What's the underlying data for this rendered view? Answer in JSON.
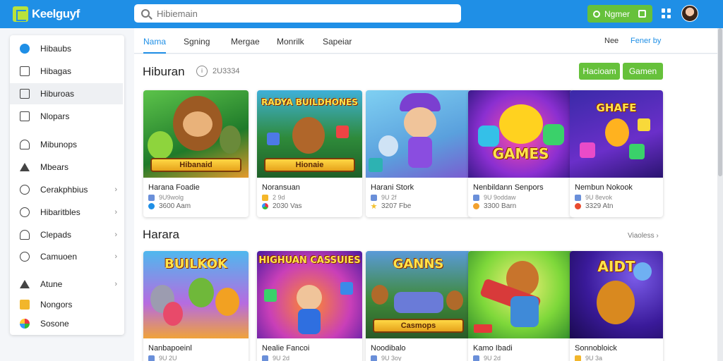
{
  "app": {
    "logo_text": "Keelguyf"
  },
  "search": {
    "placeholder": "Hibiemain"
  },
  "header": {
    "button_label": "Ngmer",
    "icons": [
      "grid-icon",
      "avatar"
    ]
  },
  "sidebar": {
    "items": [
      {
        "label": "Hibaubs",
        "icon": "globe-icon",
        "chevron": false,
        "active": false
      },
      {
        "label": "Hibagas",
        "icon": "list-icon",
        "chevron": false,
        "active": false
      },
      {
        "label": "Hiburoas",
        "icon": "document-icon",
        "chevron": false,
        "active": true
      },
      {
        "label": "Nlopars",
        "icon": "folder-icon",
        "chevron": false,
        "active": false
      },
      {
        "label": "Mibunops",
        "icon": "shirt-icon",
        "chevron": false,
        "active": false
      },
      {
        "label": "Mbears",
        "icon": "tag-icon",
        "chevron": false,
        "active": false
      },
      {
        "label": "Cerakphbius",
        "icon": "compass-icon",
        "chevron": true,
        "active": false
      },
      {
        "label": "Hibaritbles",
        "icon": "clock-icon",
        "chevron": true,
        "active": false
      },
      {
        "label": "Clepads",
        "icon": "bell-icon",
        "chevron": true,
        "active": false
      },
      {
        "label": "Camuoen",
        "icon": "info-icon",
        "chevron": true,
        "active": false
      },
      {
        "label": "Atune",
        "icon": "triangle-icon",
        "chevron": true,
        "active": false
      },
      {
        "label": "Nongors",
        "icon": "star-box-icon",
        "chevron": false,
        "active": false
      },
      {
        "label": "Sosone",
        "icon": "colorful-icon",
        "chevron": false,
        "active": false
      }
    ]
  },
  "tabs": {
    "items": [
      "Nama",
      "Sgning",
      "Mergae",
      "Monrilk",
      "Sapeiar"
    ],
    "right_label": "Nee",
    "right_link": "Fener by"
  },
  "section1": {
    "title": "Hiburan",
    "count": "2U3334",
    "buttons": [
      "Hacioam",
      "Gamen"
    ],
    "cards": [
      {
        "name": "Harana Foadie",
        "meta": "9U9wolg",
        "stat": "3600 Aam",
        "thumb_text": "Hibanaid",
        "theme": "bear-jungle"
      },
      {
        "name": "Noransuan",
        "meta": "2 9d",
        "stat": "2030 Vas",
        "thumb_text": "Hionaie",
        "theme": "puzzle-bear",
        "thumb_title": "RADYA BUILDHONES"
      },
      {
        "name": "Harani Stork",
        "meta": "9U 2f",
        "stat": "3207 Fbe",
        "thumb_text": "",
        "theme": "kid-cap"
      },
      {
        "name": "Nenbildann Senpors",
        "meta": "9U 9oddaw",
        "stat": "3300 Barn",
        "thumb_text": "GAMES",
        "theme": "controller"
      },
      {
        "name": "Nembun Nokook",
        "meta": "9U 8evok",
        "stat": "3329 Atn",
        "thumb_text": "GHAFE",
        "theme": "chick-blocks"
      }
    ]
  },
  "section2": {
    "title": "Harara",
    "see_all": "Viaoless",
    "cards": [
      {
        "name": "Nanbapoeinl",
        "meta": "9U 2U",
        "thumb_text": "BUILKOK",
        "theme": "animals"
      },
      {
        "name": "Nealie Fancoi",
        "meta": "9U 2d",
        "thumb_text": "HIGHUAN CASSUIES",
        "theme": "hero-kid"
      },
      {
        "name": "Noodibalo",
        "meta": "9U 3oy",
        "thumb_text": "GANNS",
        "theme": "gamepad-city",
        "thumb_band": "Casmops"
      },
      {
        "name": "Kamo Ibadi",
        "meta": "9U 2d",
        "thumb_text": "",
        "theme": "bear-gun"
      },
      {
        "name": "Sonnobloick",
        "meta": "9U 3a",
        "thumb_text": "AIDT",
        "theme": "space-bear"
      }
    ]
  },
  "colors": {
    "topbar": "#1f8fe6",
    "accent_green": "#66c13b",
    "active_tab": "#1f8fe6"
  }
}
